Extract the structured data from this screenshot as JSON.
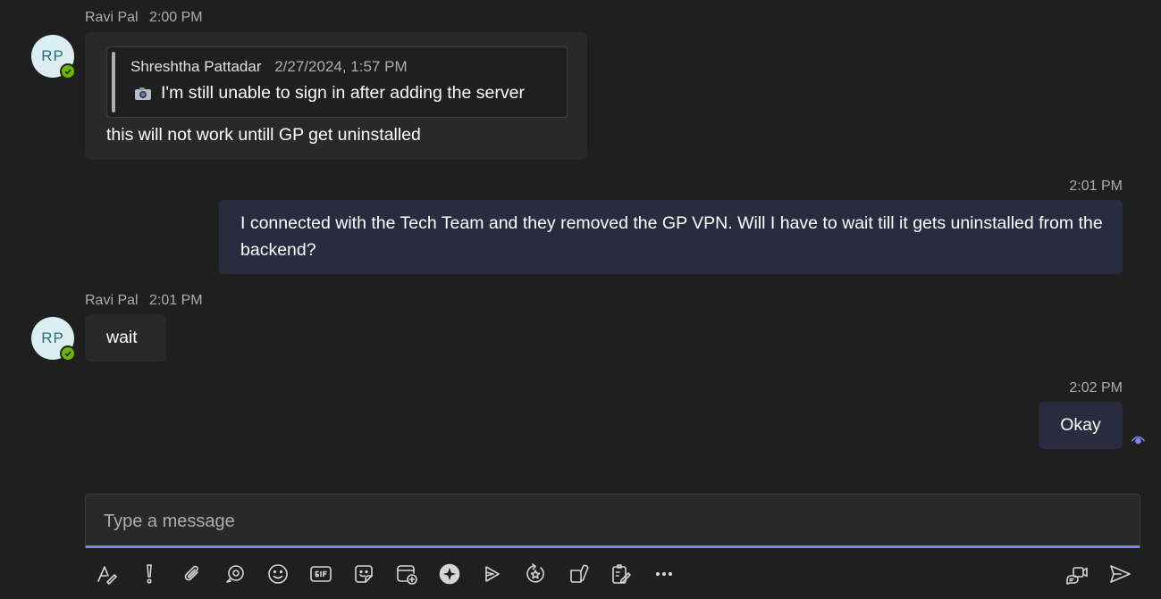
{
  "messages": [
    {
      "sender": "Ravi Pal",
      "time": "2:00 PM",
      "initials": "RP",
      "quote": {
        "author": "Shreshtha Pattadar",
        "date": "2/27/2024, 1:57 PM",
        "text": "I'm still unable to sign in after adding the server",
        "icon": "camera-icon"
      },
      "text": "this will not work untill GP get uninstalled"
    },
    {
      "time": "2:01 PM",
      "text": "I connected with the Tech Team and they removed the GP VPN. Will I have to wait till it gets uninstalled from the backend?"
    },
    {
      "sender": "Ravi Pal",
      "time": "2:01 PM",
      "initials": "RP",
      "text": "wait"
    },
    {
      "time": "2:02 PM",
      "text": "Okay",
      "status": "seen-icon"
    }
  ],
  "composer": {
    "placeholder": "Type a message"
  },
  "toolbar": [
    "format-icon",
    "important-icon",
    "attach-icon",
    "loop-icon",
    "emoji-icon",
    "gif-icon",
    "sticker-icon",
    "schedule-meeting-icon",
    "copilot-icon",
    "stream-icon",
    "praise-icon",
    "apps-icon",
    "forms-icon",
    "more-options-icon",
    "meet-now-icon",
    "send-icon"
  ],
  "colors": {
    "background": "#1f1f1f",
    "incoming_bubble": "#292929",
    "outgoing_bubble": "#2b2b40",
    "accent": "#7f85f5",
    "presence_available": "#6bb700"
  }
}
